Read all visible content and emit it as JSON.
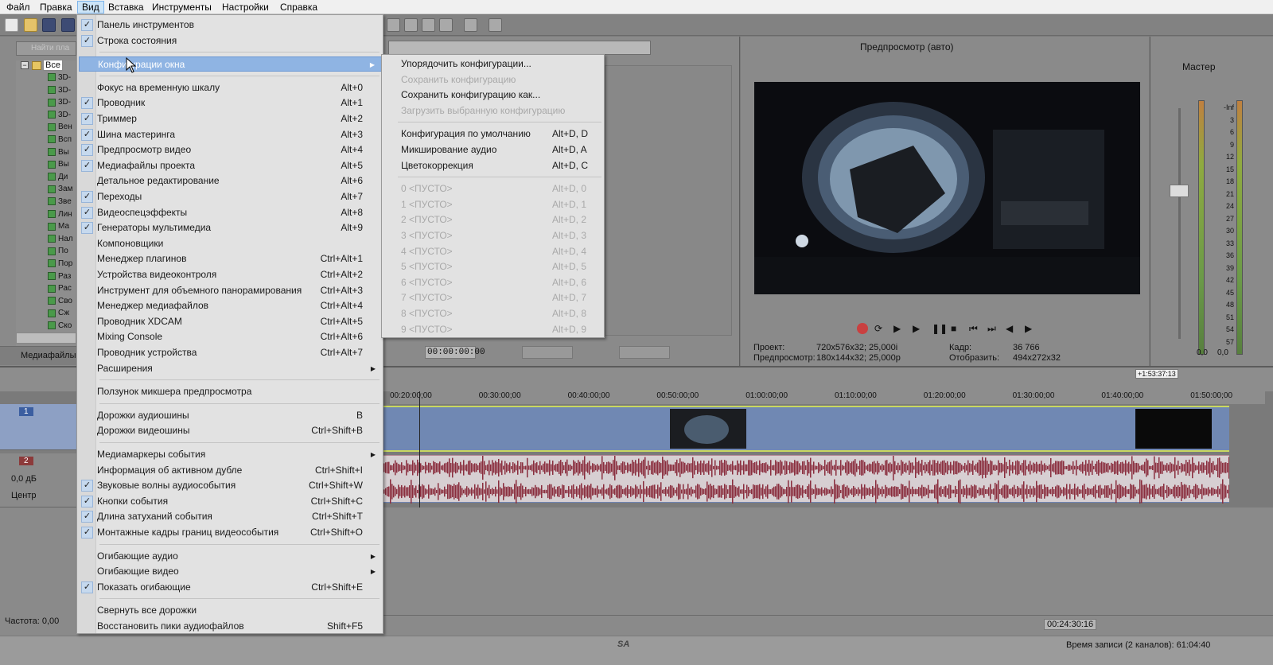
{
  "menubar": {
    "items": [
      "Файл",
      "Правка",
      "Вид",
      "Вставка",
      "Инструменты",
      "Настройки",
      "Справка"
    ],
    "active": "Вид"
  },
  "explorer": {
    "search_placeholder": "Найти пла",
    "root_label": "Все",
    "items": [
      "3D-",
      "3D-",
      "3D-",
      "3D-",
      "Вен",
      "Всп",
      "Вы",
      "Вы",
      "Ди",
      "Зам",
      "Зве",
      "Лин",
      "Ма",
      "Нал",
      "По",
      "Пор",
      "Раз",
      "Рас",
      "Сво",
      "Сж",
      "Ско"
    ],
    "tab_label": "Медиафайлы"
  },
  "view_menu": {
    "items": [
      {
        "label": "Панель инструментов",
        "checked": true,
        "accel": ""
      },
      {
        "label": "Строка состояния",
        "checked": true,
        "accel": ""
      },
      {
        "sep": true
      },
      {
        "label": "Конфигурации окна",
        "checked": false,
        "accel": "",
        "submenu": true,
        "highlight": true
      },
      {
        "sep": true
      },
      {
        "label": "Фокус на временную шкалу",
        "checked": false,
        "accel": "Alt+0"
      },
      {
        "label": "Проводник",
        "checked": true,
        "accel": "Alt+1"
      },
      {
        "label": "Триммер",
        "checked": true,
        "accel": "Alt+2"
      },
      {
        "label": "Шина мастеринга",
        "checked": true,
        "accel": "Alt+3"
      },
      {
        "label": "Предпросмотр видео",
        "checked": true,
        "accel": "Alt+4"
      },
      {
        "label": "Медиафайлы проекта",
        "checked": true,
        "accel": "Alt+5"
      },
      {
        "label": "Детальное редактирование",
        "checked": false,
        "accel": "Alt+6"
      },
      {
        "label": "Переходы",
        "checked": true,
        "accel": "Alt+7"
      },
      {
        "label": "Видеоспецэффекты",
        "checked": true,
        "accel": "Alt+8"
      },
      {
        "label": "Генераторы мультимедиа",
        "checked": true,
        "accel": "Alt+9"
      },
      {
        "label": "Компоновщики",
        "checked": false,
        "accel": ""
      },
      {
        "label": "Менеджер плагинов",
        "checked": false,
        "accel": "Ctrl+Alt+1"
      },
      {
        "label": "Устройства видеоконтроля",
        "checked": false,
        "accel": "Ctrl+Alt+2"
      },
      {
        "label": "Инструмент для объемного панорамирования",
        "checked": false,
        "accel": "Ctrl+Alt+3"
      },
      {
        "label": "Менеджер медиафайлов",
        "checked": false,
        "accel": "Ctrl+Alt+4"
      },
      {
        "label": "Проводник XDCAM",
        "checked": false,
        "accel": "Ctrl+Alt+5"
      },
      {
        "label": "Mixing Console",
        "checked": false,
        "accel": "Ctrl+Alt+6"
      },
      {
        "label": "Проводник устройства",
        "checked": false,
        "accel": "Ctrl+Alt+7"
      },
      {
        "label": "Расширения",
        "checked": false,
        "accel": "",
        "submenu": true
      },
      {
        "sep": true
      },
      {
        "label": "Ползунок микшера предпросмотра",
        "checked": false,
        "accel": ""
      },
      {
        "sep": true
      },
      {
        "label": "Дорожки аудиошины",
        "checked": false,
        "accel": "B"
      },
      {
        "label": "Дорожки видеошины",
        "checked": false,
        "accel": "Ctrl+Shift+B"
      },
      {
        "sep": true
      },
      {
        "label": "Медиамаркеры события",
        "checked": false,
        "accel": "",
        "submenu": true
      },
      {
        "label": "Информация об активном дубле",
        "checked": false,
        "accel": "Ctrl+Shift+I"
      },
      {
        "label": "Звуковые волны аудиособытия",
        "checked": true,
        "accel": "Ctrl+Shift+W"
      },
      {
        "label": "Кнопки события",
        "checked": true,
        "accel": "Ctrl+Shift+C"
      },
      {
        "label": "Длина затуханий события",
        "checked": true,
        "accel": "Ctrl+Shift+T"
      },
      {
        "label": "Монтажные кадры границ видеособытия",
        "checked": true,
        "accel": "Ctrl+Shift+O"
      },
      {
        "sep": true
      },
      {
        "label": "Огибающие аудио",
        "checked": false,
        "accel": "",
        "submenu": true
      },
      {
        "label": "Огибающие видео",
        "checked": false,
        "accel": "",
        "submenu": true
      },
      {
        "label": "Показать огибающие",
        "checked": true,
        "accel": "Ctrl+Shift+E"
      },
      {
        "sep": true
      },
      {
        "label": "Свернуть все дорожки",
        "checked": false,
        "accel": ""
      },
      {
        "label": "Восстановить пики аудиофайлов",
        "checked": false,
        "accel": "Shift+F5"
      }
    ]
  },
  "window_config_menu": {
    "items": [
      {
        "label": "Упорядочить конфигурации...",
        "accel": "",
        "disabled": false
      },
      {
        "label": "Сохранить конфигурацию",
        "accel": "",
        "disabled": true
      },
      {
        "label": "Сохранить конфигурацию как...",
        "accel": "",
        "disabled": false
      },
      {
        "label": "Загрузить выбранную конфигурацию",
        "accel": "",
        "disabled": true
      },
      {
        "sep": true
      },
      {
        "label": "Конфигурация по умолчанию",
        "accel": "Alt+D, D",
        "disabled": false
      },
      {
        "label": "Микширование аудио",
        "accel": "Alt+D, A",
        "disabled": false
      },
      {
        "label": "Цветокоррекция",
        "accel": "Alt+D, C",
        "disabled": false
      },
      {
        "sep": true
      },
      {
        "label": "0 <ПУСТО>",
        "accel": "Alt+D, 0",
        "disabled": true
      },
      {
        "label": "1 <ПУСТО>",
        "accel": "Alt+D, 1",
        "disabled": true
      },
      {
        "label": "2 <ПУСТО>",
        "accel": "Alt+D, 2",
        "disabled": true
      },
      {
        "label": "3 <ПУСТО>",
        "accel": "Alt+D, 3",
        "disabled": true
      },
      {
        "label": "4 <ПУСТО>",
        "accel": "Alt+D, 4",
        "disabled": true
      },
      {
        "label": "5 <ПУСТО>",
        "accel": "Alt+D, 5",
        "disabled": true
      },
      {
        "label": "6 <ПУСТО>",
        "accel": "Alt+D, 6",
        "disabled": true
      },
      {
        "label": "7 <ПУСТО>",
        "accel": "Alt+D, 7",
        "disabled": true
      },
      {
        "label": "8 <ПУСТО>",
        "accel": "Alt+D, 8",
        "disabled": true
      },
      {
        "label": "9 <ПУСТО>",
        "accel": "Alt+D, 9",
        "disabled": true
      }
    ]
  },
  "trimmer": {
    "time": "00:00:00:00"
  },
  "preview": {
    "mode_label": "Предпросмотр (авто)",
    "project_label": "Проект:",
    "project_value": "720x576x32; 25,000i",
    "preview_label": "Предпросмотр:",
    "preview_value": "180x144x32; 25,000p",
    "frame_label": "Кадр:",
    "frame_value": "36 766",
    "display_label": "Отобразить:",
    "display_value": "494x272x32"
  },
  "master": {
    "label": "Мастер",
    "scale": [
      "-Inf",
      "3",
      "6",
      "9",
      "12",
      "15",
      "18",
      "21",
      "24",
      "27",
      "30",
      "33",
      "36",
      "39",
      "42",
      "45",
      "48",
      "51",
      "54",
      "57"
    ],
    "bottom_left": "0,0",
    "bottom_right": "0,0"
  },
  "timeline": {
    "duration_badge": "+1:53:37:13",
    "ruler": [
      "00:20:00;00",
      "00:30:00;00",
      "00:40:00;00",
      "00:50:00;00",
      "01:00:00;00",
      "01:10:00;00",
      "01:20:00;00",
      "01:30:00;00",
      "01:40:00;00",
      "01:50:00;00"
    ],
    "track1_num": "1",
    "track2_num": "2",
    "volume": "0,0 дБ",
    "pan": "Центр",
    "rate": "Частота: 0,00",
    "cursor_time": "00:24:30:16"
  },
  "status": {
    "record_time": "Время записи (2 каналов): 61:04:40",
    "watermark": "SA"
  }
}
